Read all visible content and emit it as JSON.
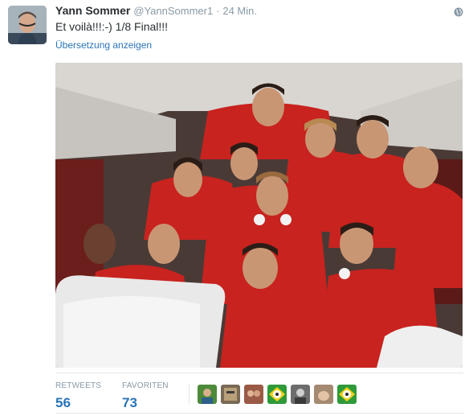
{
  "tweet": {
    "fullname": "Yann Sommer",
    "username": "@YannSommer1",
    "separator": "·",
    "time": "24 Min.",
    "text": "Et voilà!!!:-) 1/8 Final!!!",
    "translate_label": "Übersetzung anzeigen",
    "globe_icon": "globe-icon"
  },
  "stats": {
    "retweets_label": "RETWEETS",
    "retweets_value": "56",
    "favorites_label": "FAVORITEN",
    "favorites_value": "73"
  },
  "favoriter_avatars": [
    {
      "icon": "avatar-green-field",
      "color": "#4d8a3a"
    },
    {
      "icon": "avatar-poster",
      "color": "#7a6a55"
    },
    {
      "icon": "avatar-couple",
      "color": "#9a5a45"
    },
    {
      "icon": "avatar-brazil-ball",
      "color": "#2f9a3a"
    },
    {
      "icon": "avatar-portrait",
      "color": "#6d6d6d"
    },
    {
      "icon": "avatar-hand",
      "color": "#a58a72"
    },
    {
      "icon": "avatar-brazil-ball",
      "color": "#2f9a3a"
    }
  ],
  "colors": {
    "link": "#2a74b5",
    "muted": "#8899a6",
    "jersey_red": "#c8231f"
  }
}
